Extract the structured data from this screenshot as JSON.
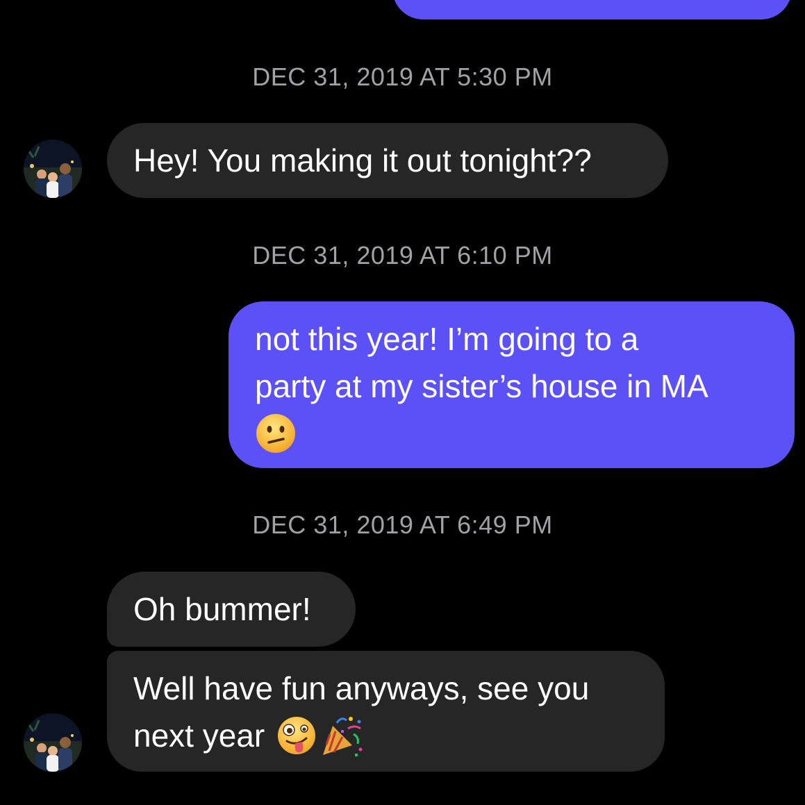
{
  "thread": {
    "messages": [
      {
        "timestamp": "DEC 31, 2019 AT 5:30 PM",
        "text": "Hey! You making it out tonight??"
      },
      {
        "timestamp": "DEC 31, 2019 AT 6:10 PM",
        "line1": "not this year! I’m going to a",
        "line2": "party at my sister’s house in MA"
      },
      {
        "timestamp": "DEC 31, 2019 AT 6:49 PM",
        "text": "Oh bummer!"
      },
      {
        "line1": "Well have fun anyways, see you",
        "line2": "next year"
      }
    ]
  },
  "colors": {
    "background": "#000000",
    "incoming_bubble": "#262626",
    "outgoing_bubble": "#5b51f6",
    "timestamp_text": "#a1a1a6"
  },
  "icons": {
    "confused_emoji": "confused-face-emoji",
    "zany_emoji": "zany-face-emoji",
    "party_emoji": "party-popper-emoji",
    "avatar": "contact-avatar-photo"
  }
}
